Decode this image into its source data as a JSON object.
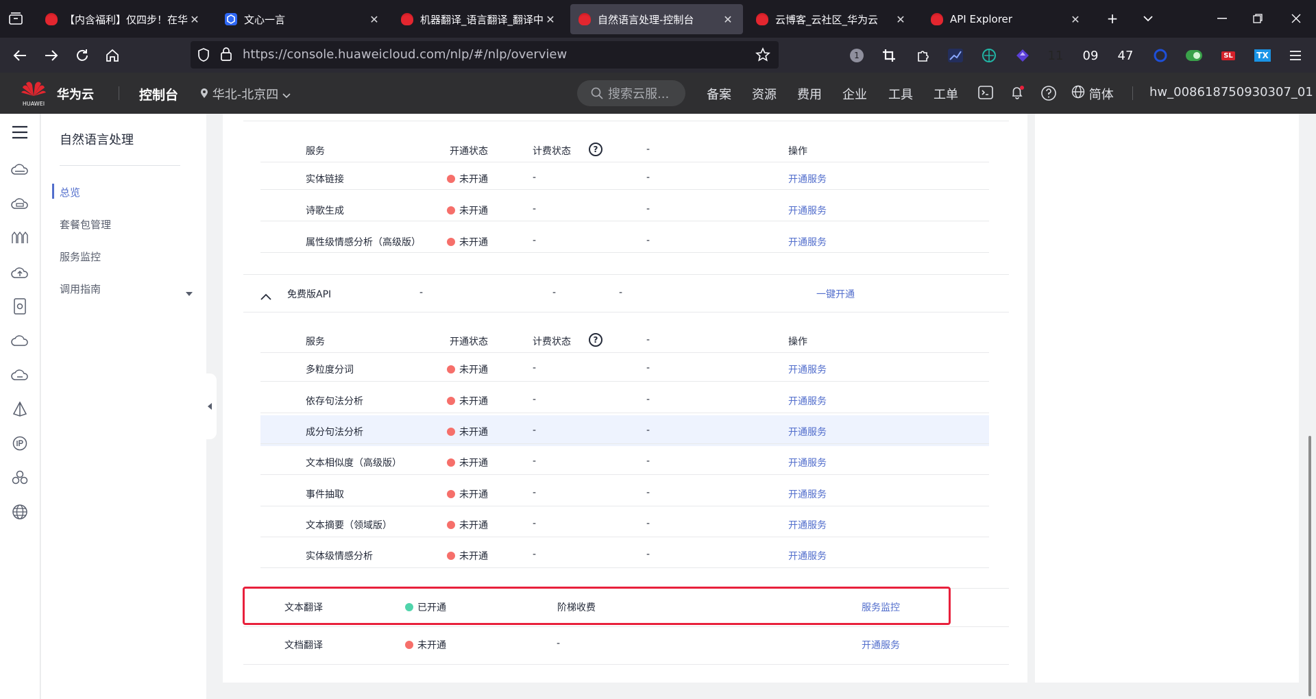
{
  "browser": {
    "tabs": [
      {
        "title": "【内含福利】仅四步！在华为",
        "icon": "huawei-logo-icon"
      },
      {
        "title": "文心一言",
        "icon": "wenxin-icon"
      },
      {
        "title": "机器翻译_语言翻译_翻译中心",
        "icon": "huawei-logo-icon"
      },
      {
        "title": "自然语言处理-控制台",
        "icon": "huawei-logo-icon"
      },
      {
        "title": "云博客_云社区_华为云",
        "icon": "huawei-logo-icon"
      },
      {
        "title": "API Explorer",
        "icon": "huawei-logo-icon"
      }
    ],
    "active_tab": 3,
    "url": "https://console.huaweicloud.com/nlp/#/nlp/overview",
    "ext_badges": [
      "1",
      "11",
      "09",
      "47",
      "SL",
      "TX"
    ],
    "close": "✕",
    "new_tab": "+",
    "list": "⌄"
  },
  "console": {
    "logo_text": "HUAWEI",
    "brand": "华为云",
    "console_label": "控制台",
    "region": "华北-北京四",
    "search_placeholder": "搜索云服...",
    "nav": [
      "备案",
      "资源",
      "费用",
      "企业",
      "工具",
      "工单"
    ],
    "lang": "简体",
    "user": "hw_008618750930307_01"
  },
  "leftnav": {
    "title": "自然语言处理",
    "items": [
      "总览",
      "套餐包管理",
      "服务监控",
      "调用指南"
    ]
  },
  "table": {
    "headers": {
      "service": "服务",
      "status": "开通状态",
      "billing": "计费状态",
      "dash": "-",
      "action": "操作"
    },
    "group1_rows": [
      {
        "name": "实体链接",
        "status": "未开通",
        "billing": "-",
        "dash": "-",
        "action": "开通服务"
      },
      {
        "name": "诗歌生成",
        "status": "未开通",
        "billing": "-",
        "dash": "-",
        "action": "开通服务"
      },
      {
        "name": "属性级情感分析（高级版）",
        "status": "未开通",
        "billing": "-",
        "dash": "-",
        "action": "开通服务"
      }
    ],
    "free_group": {
      "name": "免费版API",
      "c1": "-",
      "c2": "-",
      "c3": "-",
      "action": "一键开通"
    },
    "group2_rows": [
      {
        "name": "多粒度分词",
        "status": "未开通",
        "billing": "-",
        "dash": "-",
        "action": "开通服务"
      },
      {
        "name": "依存句法分析",
        "status": "未开通",
        "billing": "-",
        "dash": "-",
        "action": "开通服务"
      },
      {
        "name": "成分句法分析",
        "status": "未开通",
        "billing": "-",
        "dash": "-",
        "action": "开通服务"
      },
      {
        "name": "文本相似度（高级版）",
        "status": "未开通",
        "billing": "-",
        "dash": "-",
        "action": "开通服务"
      },
      {
        "name": "事件抽取",
        "status": "未开通",
        "billing": "-",
        "dash": "-",
        "action": "开通服务"
      },
      {
        "name": "文本摘要（领域版）",
        "status": "未开通",
        "billing": "-",
        "dash": "-",
        "action": "开通服务"
      },
      {
        "name": "实体级情感分析",
        "status": "未开通",
        "billing": "-",
        "dash": "-",
        "action": "开通服务"
      }
    ],
    "translation_rows": [
      {
        "name": "文本翻译",
        "status": "已开通",
        "billing": "阶梯收费",
        "action": "服务监控"
      },
      {
        "name": "文档翻译",
        "status": "未开通",
        "billing": "-",
        "action": "开通服务"
      }
    ]
  },
  "colors": {
    "inactive": "#f66f6a",
    "active": "#50d4ab",
    "link": "#526ecc",
    "highlight": "#e8203c"
  }
}
